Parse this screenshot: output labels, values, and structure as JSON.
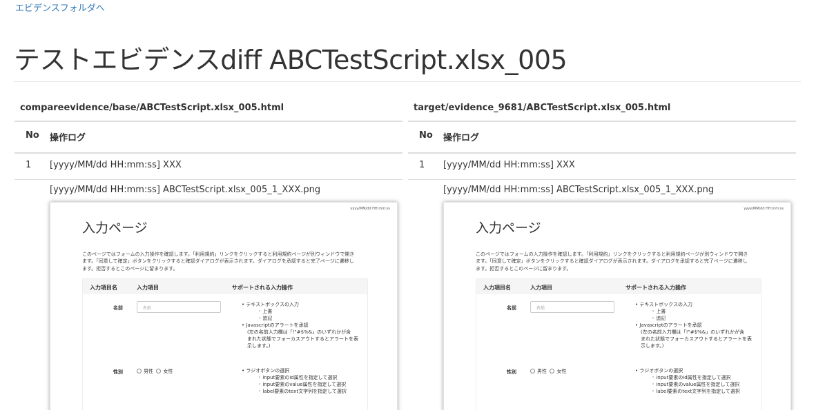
{
  "nav": {
    "back_link": "エビデンスフォルダへ"
  },
  "page_title": "テストエビデンスdiff ABCTestScript.xlsx_005",
  "columns": [
    {
      "file": "compareevidence/base/ABCTestScript.xlsx_005.html",
      "header_no": "No",
      "header_log": "操作ログ",
      "row_no": "1",
      "row_log": "[yyyy/MM/dd HH:mm:ss] XXX",
      "image_caption": "[yyyy/MM/dd HH:mm:ss] ABCTestScript.xlsx_005_1_XXX.png"
    },
    {
      "file": "target/evidence_9681/ABCTestScript.xlsx_005.html",
      "header_no": "No",
      "header_log": "操作ログ",
      "row_no": "1",
      "row_log": "[yyyy/MM/dd HH:mm:ss] XXX",
      "image_caption": "[yyyy/MM/dd HH:mm:ss] ABCTestScript.xlsx_005_1_XXX.png"
    }
  ],
  "screenshot": {
    "timestamp": "yyyy/MM/dd HH:mm:ss",
    "title": "入力ページ",
    "desc_1": "このページではフォームの入力操作を確認します。「利用規約」リンクをクリックすると利用規約ページが別ウィンドウで開き",
    "desc_2": "ます。「同意して確定」ボタンをクリックすると確認ダイアログが表示されます。ダイアログを承認すると完了ページに遷移し",
    "desc_3": "ます。拒否するとこのページに留まります。",
    "col_item_name": "入力項目名",
    "col_item": "入力項目",
    "col_ops": "サポートされる入力操作",
    "name_label": "名前",
    "name_placeholder": "名前",
    "name_op_1": "テキストボックスの入力",
    "name_op_1a": "上書",
    "name_op_1b": "追記",
    "name_op_2": "Javascriptのアラートを承認",
    "name_op_2a": "(左の名前入力欄は「!\"#$%&」のいずれかが含",
    "name_op_2b": "まれた状態でフォーカスアウトするとアラートを表",
    "name_op_2c": "示します。)",
    "gender_label": "性別",
    "gender_male": "男性",
    "gender_female": "女性",
    "gender_op_1": "ラジオボタンの選択",
    "gender_op_1a": "input要素のid属性を指定して選択",
    "gender_op_1b": "input要素のvalue属性を指定して選択",
    "gender_op_1c": "label要素のtext文字列を指定して選択"
  }
}
